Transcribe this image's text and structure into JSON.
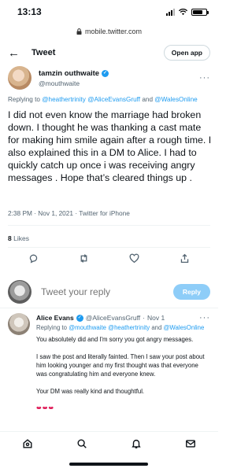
{
  "status_bar": {
    "time": "13:13"
  },
  "browser": {
    "url": "mobile.twitter.com"
  },
  "nav": {
    "title": "Tweet",
    "open_app": "Open app"
  },
  "tweet": {
    "author_name": "tamzin outhwaite",
    "author_handle": "@mouthwaite",
    "replying_prefix": "Replying to",
    "replying_to": [
      "@heathertrinity",
      "@AliceEvansGruff",
      "@WalesOnline"
    ],
    "replying_and": "and",
    "text": "I did not even know the marriage had broken down. I thought he was thanking a cast mate for making him smile again after a rough time. I also explained this in a DM to Alice. I had to quickly catch up once i was receiving angry messages . Hope that’s cleared things up .",
    "time": "2:38 PM",
    "date": "Nov 1, 2021",
    "source": "Twitter for iPhone",
    "likes_count": "8",
    "likes_label": "Likes"
  },
  "compose": {
    "placeholder": "Tweet your reply",
    "button": "Reply"
  },
  "reply": {
    "author_name": "Alice Evans",
    "author_handle": "@AliceEvansGruff",
    "dot": "·",
    "date": "Nov 1",
    "replying_prefix": "Replying to",
    "replying_to": [
      "@mouthwaite",
      "@heathertrinity",
      "@WalesOnline"
    ],
    "replying_and": "and",
    "paragraphs": [
      "You absolutely did and I'm sorry you got angry messages.",
      "I saw the post and literally fainted. Then I saw your post about him looking younger and my first thought was that everyone was congratulating him and everyone knew.",
      "Your DM was really kind and thoughtful."
    ],
    "hearts": "❤❤❤"
  },
  "icons": {
    "back": "arrow-left-icon",
    "more": "more-horizontal-icon",
    "lock": "lock-icon",
    "verified": "verified-badge-icon"
  },
  "colors": {
    "accent": "#1d9bf0",
    "reply_button": "#8ecdf8",
    "secondary_text": "#536471"
  }
}
